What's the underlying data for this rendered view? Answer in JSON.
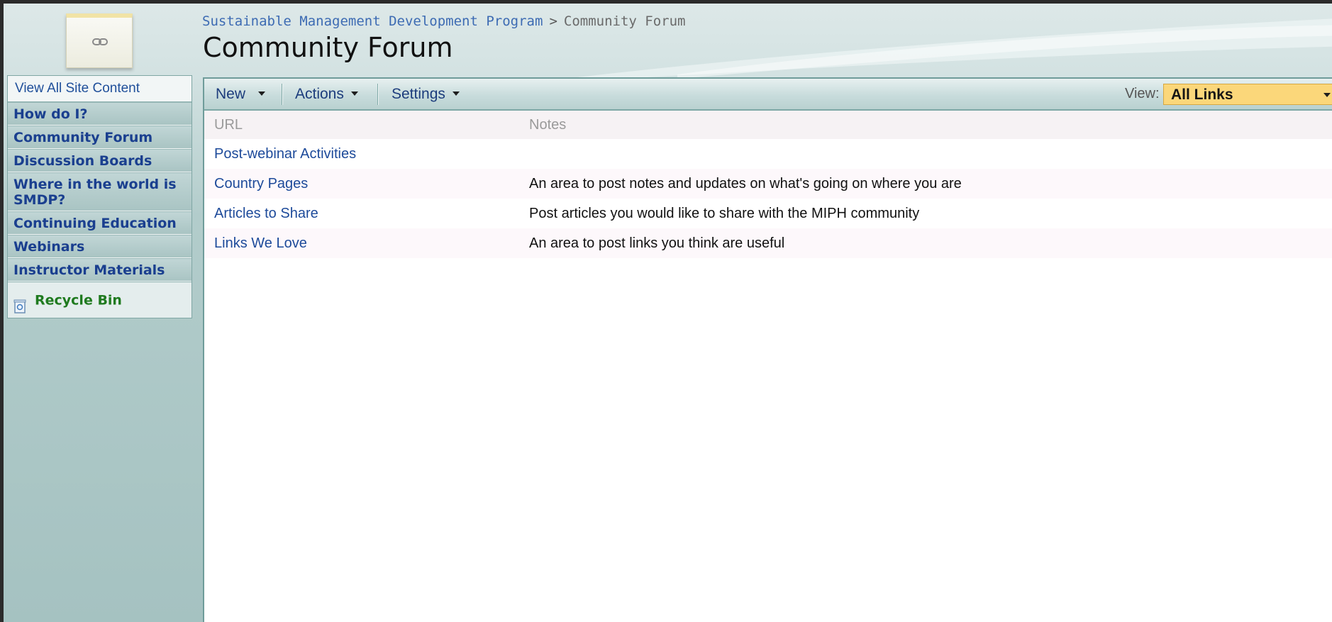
{
  "breadcrumb": {
    "site": "Sustainable Management Development Program",
    "separator": ">",
    "current": "Community Forum"
  },
  "page": {
    "title": "Community Forum",
    "logo_icon": "link-icon"
  },
  "quick_launch": {
    "view_all": "View All Site Content",
    "items": [
      "How do I?",
      "Community Forum",
      "Discussion Boards",
      "Where in the world is SMDP?",
      "Continuing Education",
      "Webinars",
      "Instructor Materials"
    ],
    "recycle_bin": "Recycle Bin"
  },
  "toolbar": {
    "new_label": "New",
    "actions_label": "Actions",
    "settings_label": "Settings",
    "view_label": "View:",
    "view_value": "All Links"
  },
  "table": {
    "columns": [
      "URL",
      "Notes"
    ],
    "rows": [
      {
        "url": "Post-webinar Activities",
        "notes": ""
      },
      {
        "url": "Country Pages",
        "notes": "An area to post notes and updates on what's going on where you are"
      },
      {
        "url": "Articles to Share",
        "notes": "Post articles you would like to share with the MIPH community"
      },
      {
        "url": "Links We Love",
        "notes": "An area to post links you think are useful"
      }
    ]
  },
  "colors": {
    "accent_link": "#1d4a9a",
    "view_select_bg": "#fbd77a",
    "recycle_green": "#1f7a1f"
  }
}
